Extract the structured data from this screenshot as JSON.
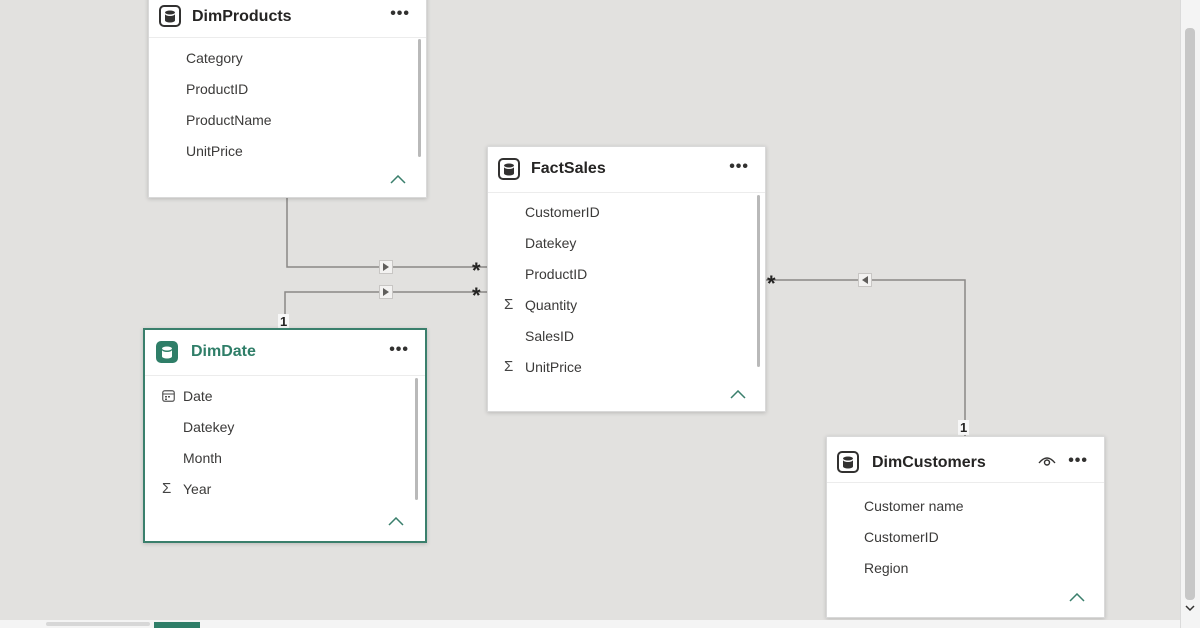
{
  "tables": {
    "dim_products": {
      "title": "DimProducts",
      "fields": [
        {
          "name": "Category",
          "icon": ""
        },
        {
          "name": "ProductID",
          "icon": ""
        },
        {
          "name": "ProductName",
          "icon": ""
        },
        {
          "name": "UnitPrice",
          "icon": ""
        }
      ]
    },
    "fact_sales": {
      "title": "FactSales",
      "fields": [
        {
          "name": "CustomerID",
          "icon": ""
        },
        {
          "name": "Datekey",
          "icon": ""
        },
        {
          "name": "ProductID",
          "icon": ""
        },
        {
          "name": "Quantity",
          "icon": "sigma-icon"
        },
        {
          "name": "SalesID",
          "icon": ""
        },
        {
          "name": "UnitPrice",
          "icon": "sigma-icon"
        }
      ]
    },
    "dim_date": {
      "title": "DimDate",
      "fields": [
        {
          "name": "Date",
          "icon": "calendar-icon"
        },
        {
          "name": "Datekey",
          "icon": ""
        },
        {
          "name": "Month",
          "icon": ""
        },
        {
          "name": "Year",
          "icon": "sigma-icon"
        }
      ]
    },
    "dim_customers": {
      "title": "DimCustomers",
      "fields": [
        {
          "name": "Customer name",
          "icon": ""
        },
        {
          "name": "CustomerID",
          "icon": ""
        },
        {
          "name": "Region",
          "icon": ""
        }
      ]
    }
  },
  "relationships": {
    "many_symbol": "*",
    "one_symbol": "1"
  },
  "colors": {
    "accent": "#2f7e68",
    "canvas": "#e2e1df",
    "line": "#8a8886"
  }
}
